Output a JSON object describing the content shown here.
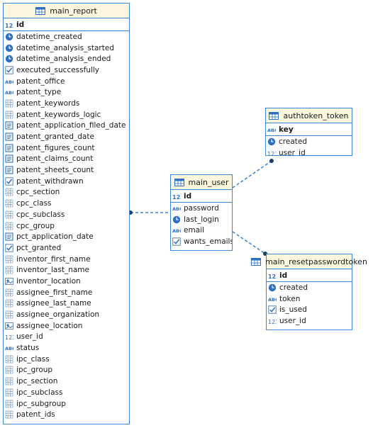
{
  "icon_types": {
    "num": "number-type-icon",
    "time": "clock-type-icon",
    "bool": "checkbox-type-icon",
    "text": "text-type-icon",
    "grid": "array-type-icon",
    "doc": "document-type-icon",
    "geo": "location-type-icon"
  },
  "colors": {
    "accent": "#3a86d4",
    "header_bg": "#fbf7dd"
  },
  "main_report": {
    "title": "main_report",
    "pk": "id",
    "columns": [
      {
        "name": "datetime_created",
        "type": "time"
      },
      {
        "name": "datetime_analysis_started",
        "type": "time"
      },
      {
        "name": "datetime_analysis_ended",
        "type": "time"
      },
      {
        "name": "executed_successfully",
        "type": "bool"
      },
      {
        "name": "patent_office",
        "type": "text"
      },
      {
        "name": "patent_type",
        "type": "text"
      },
      {
        "name": "patent_keywords",
        "type": "grid"
      },
      {
        "name": "patent_keywords_logic",
        "type": "grid"
      },
      {
        "name": "patent_application_filed_date",
        "type": "doc"
      },
      {
        "name": "patent_granted_date",
        "type": "doc"
      },
      {
        "name": "patent_figures_count",
        "type": "doc"
      },
      {
        "name": "patent_claims_count",
        "type": "doc"
      },
      {
        "name": "patent_sheets_count",
        "type": "doc"
      },
      {
        "name": "patent_withdrawn",
        "type": "bool"
      },
      {
        "name": "cpc_section",
        "type": "grid"
      },
      {
        "name": "cpc_class",
        "type": "grid"
      },
      {
        "name": "cpc_subclass",
        "type": "grid"
      },
      {
        "name": "cpc_group",
        "type": "grid"
      },
      {
        "name": "pct_application_date",
        "type": "doc"
      },
      {
        "name": "pct_granted",
        "type": "bool"
      },
      {
        "name": "inventor_first_name",
        "type": "grid"
      },
      {
        "name": "inventor_last_name",
        "type": "grid"
      },
      {
        "name": "inventor_location",
        "type": "geo"
      },
      {
        "name": "assignee_first_name",
        "type": "grid"
      },
      {
        "name": "assignee_last_name",
        "type": "grid"
      },
      {
        "name": "assignee_organization",
        "type": "grid"
      },
      {
        "name": "assignee_location",
        "type": "geo"
      },
      {
        "name": "user_id",
        "type": "num"
      },
      {
        "name": "status",
        "type": "text"
      },
      {
        "name": "ipc_class",
        "type": "grid"
      },
      {
        "name": "ipc_group",
        "type": "grid"
      },
      {
        "name": "ipc_section",
        "type": "grid"
      },
      {
        "name": "ipc_subclass",
        "type": "grid"
      },
      {
        "name": "ipc_subgroup",
        "type": "grid"
      },
      {
        "name": "patent_ids",
        "type": "grid"
      }
    ]
  },
  "main_user": {
    "title": "main_user",
    "pk": "id",
    "columns": [
      {
        "name": "password",
        "type": "text"
      },
      {
        "name": "last_login",
        "type": "time"
      },
      {
        "name": "email",
        "type": "text"
      },
      {
        "name": "wants_emails",
        "type": "bool"
      }
    ]
  },
  "authtoken_token": {
    "title": "authtoken_token",
    "pk": "key",
    "pk_type": "text",
    "columns": [
      {
        "name": "created",
        "type": "time"
      },
      {
        "name": "user_id",
        "type": "num"
      }
    ]
  },
  "main_resetpasswordtoken": {
    "title": "main_resetpasswordtoken",
    "pk": "id",
    "columns": [
      {
        "name": "created",
        "type": "time"
      },
      {
        "name": "token",
        "type": "text"
      },
      {
        "name": "is_used",
        "type": "bool"
      },
      {
        "name": "user_id",
        "type": "num"
      }
    ]
  }
}
